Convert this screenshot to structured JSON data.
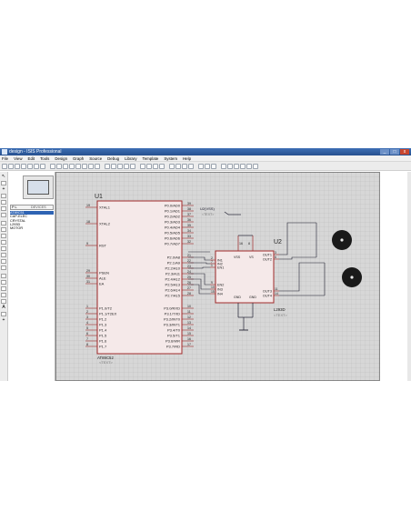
{
  "window": {
    "title": "design - ISIS Professional",
    "window_buttons": [
      "_",
      "□",
      "x"
    ]
  },
  "menu": [
    "File",
    "View",
    "Edit",
    "Tools",
    "Design",
    "Graph",
    "Source",
    "Debug",
    "Library",
    "Template",
    "System",
    "Help"
  ],
  "device_panel": {
    "pick_button": "P",
    "lock_button": "L",
    "title": "DEVICES",
    "items": [
      "AT89C51",
      "CAP-ELEC",
      "CRYSTAL",
      "L293D",
      "MOTOR"
    ],
    "selected_index": 0
  },
  "schematic": {
    "u1": {
      "ref": "U1",
      "part": "AT89C52",
      "text_placeholder": "<TEXT>",
      "left_pins": [
        {
          "num": "19",
          "name": "XTAL1"
        },
        {
          "num": "18",
          "name": "XTAL2"
        },
        {
          "num": "9",
          "name": "RST"
        },
        {
          "num": "29",
          "name": "PSEN"
        },
        {
          "num": "30",
          "name": "ALE"
        },
        {
          "num": "31",
          "name": "EA"
        },
        {
          "num": "1",
          "name": "P1.0/T2"
        },
        {
          "num": "2",
          "name": "P1.1/T2EX"
        },
        {
          "num": "3",
          "name": "P1.2"
        },
        {
          "num": "4",
          "name": "P1.3"
        },
        {
          "num": "5",
          "name": "P1.4"
        },
        {
          "num": "6",
          "name": "P1.5"
        },
        {
          "num": "7",
          "name": "P1.6"
        },
        {
          "num": "8",
          "name": "P1.7"
        }
      ],
      "right_pins": [
        {
          "num": "39",
          "name": "P0.0/AD0"
        },
        {
          "num": "38",
          "name": "P0.1/AD1"
        },
        {
          "num": "37",
          "name": "P0.2/AD2"
        },
        {
          "num": "36",
          "name": "P0.3/AD3"
        },
        {
          "num": "35",
          "name": "P0.4/AD4"
        },
        {
          "num": "34",
          "name": "P0.5/AD5"
        },
        {
          "num": "33",
          "name": "P0.6/AD6"
        },
        {
          "num": "32",
          "name": "P0.7/AD7"
        },
        {
          "num": "21",
          "name": "P2.0/A8"
        },
        {
          "num": "22",
          "name": "P2.1/A9"
        },
        {
          "num": "23",
          "name": "P2.2/A10"
        },
        {
          "num": "24",
          "name": "P2.3/A11"
        },
        {
          "num": "25",
          "name": "P2.4/A12"
        },
        {
          "num": "26",
          "name": "P2.5/A13"
        },
        {
          "num": "27",
          "name": "P2.6/A14"
        },
        {
          "num": "28",
          "name": "P2.7/A15"
        },
        {
          "num": "10",
          "name": "P3.0/RXD"
        },
        {
          "num": "11",
          "name": "P3.1/TXD"
        },
        {
          "num": "12",
          "name": "P3.2/INT0"
        },
        {
          "num": "13",
          "name": "P3.3/INT1"
        },
        {
          "num": "14",
          "name": "P3.4/T0"
        },
        {
          "num": "15",
          "name": "P3.5/T1"
        },
        {
          "num": "16",
          "name": "P3.6/WR"
        },
        {
          "num": "17",
          "name": "P3.7/RD"
        }
      ]
    },
    "u2": {
      "ref": "U2",
      "part": "L293D",
      "text_placeholder": "<TEXT>",
      "top_pins": [
        "16",
        "8"
      ],
      "left_pins": [
        {
          "num": "2",
          "name": "IN1"
        },
        {
          "num": "7",
          "name": "IN2"
        },
        {
          "num": "1",
          "name": "EN1"
        },
        {
          "num": "9",
          "name": "EN2"
        },
        {
          "num": "10",
          "name": "IN3"
        },
        {
          "num": "15",
          "name": "IN4"
        }
      ],
      "right_pins": [
        {
          "num": "3",
          "name": "OUT1"
        },
        {
          "num": "6",
          "name": "OUT2"
        },
        {
          "num": "11",
          "name": "OUT3"
        },
        {
          "num": "14",
          "name": "OUT4"
        }
      ],
      "inner_labels": [
        "VSS",
        "VS",
        "GND",
        "GND"
      ]
    },
    "power_terminal": {
      "label": "U2(VSS)",
      "text": "<TEXT>"
    }
  }
}
